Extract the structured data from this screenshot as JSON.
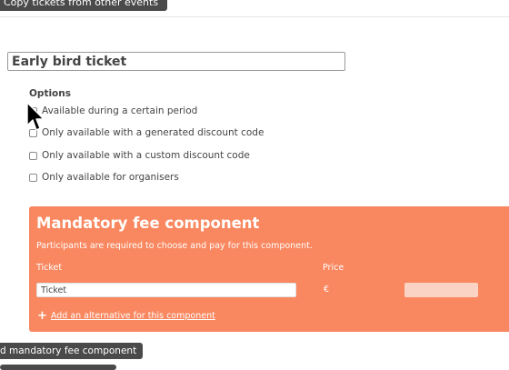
{
  "toolbar": {
    "copy_tickets_label": "Copy tickets from other events"
  },
  "ticket": {
    "name_value": "Early bird ticket"
  },
  "options": {
    "title": "Options",
    "items": [
      {
        "label": "Available during a certain period",
        "checked": false
      },
      {
        "label": "Only available with a generated discount code",
        "checked": false
      },
      {
        "label": "Only available with a custom discount code",
        "checked": false
      },
      {
        "label": "Only available for organisers",
        "checked": false
      }
    ]
  },
  "fee_component": {
    "title": "Mandatory fee component",
    "description": "Participants are required to choose and pay for this component.",
    "col_ticket": "Ticket",
    "col_price": "Price",
    "ticket_value": "Ticket",
    "currency_symbol": "€",
    "price_value": "",
    "add_alternative_label": "Add an alternative for this component",
    "accent_color": "#f9875f"
  },
  "footer": {
    "add_fee_label": "d mandatory fee component"
  }
}
